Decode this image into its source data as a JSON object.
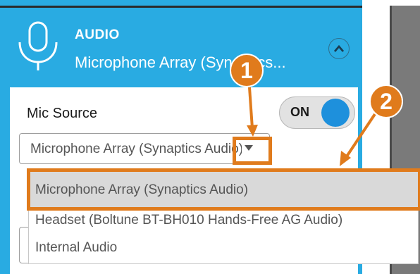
{
  "header": {
    "section_title": "AUDIO",
    "device_name": "Microphone Array (Synaptics...",
    "mic_icon": "microphone-icon",
    "collapse_icon": "chevron-up-icon"
  },
  "mic_source": {
    "label": "Mic Source",
    "toggle_label": "ON",
    "toggle_state": "on",
    "select_value": "Microphone Array (Synaptics Audio)",
    "select_arrow_icon": "caret-down-icon",
    "options": [
      {
        "label": "Microphone Array (Synaptics Audio)",
        "selected": true
      },
      {
        "label": "Headset (Boltune BT-BH010 Hands-Free AG Audio)",
        "selected": false
      },
      {
        "label": "Internal Audio",
        "selected": false
      }
    ]
  },
  "annotations": {
    "step_1": "1",
    "step_2": "2",
    "color": "#e07b1c"
  },
  "colors": {
    "panel_blue": "#29abe2",
    "toggle_blue": "#1e90dc"
  }
}
